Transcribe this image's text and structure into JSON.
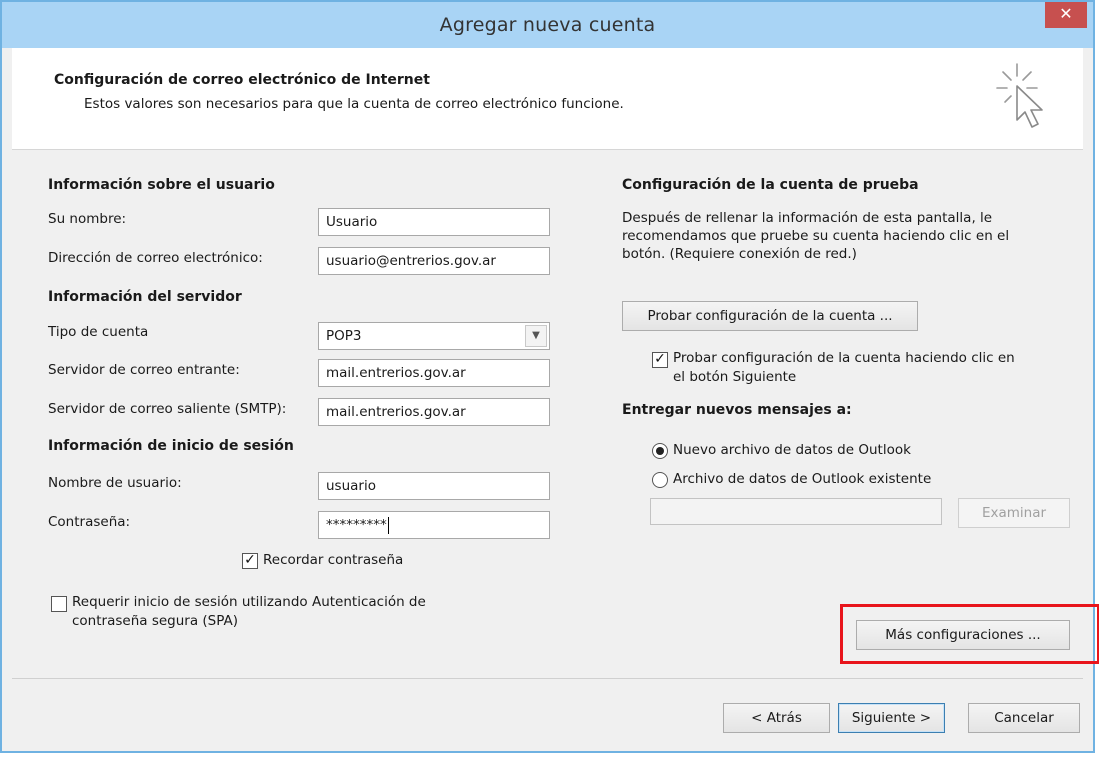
{
  "window": {
    "title": "Agregar nueva cuenta",
    "close_symbol": "✕"
  },
  "header": {
    "title": "Configuración de correo electrónico de Internet",
    "subtitle": "Estos valores son necesarios para que la cuenta de correo electrónico funcione."
  },
  "user_info": {
    "heading": "Información sobre el usuario",
    "name_label": "Su nombre:",
    "name_value": "Usuario",
    "email_label": "Dirección de correo electrónico:",
    "email_value": "usuario@entrerios.gov.ar"
  },
  "server_info": {
    "heading": "Información del servidor",
    "account_type_label": "Tipo de cuenta",
    "account_type_value": "POP3",
    "incoming_label": "Servidor de correo entrante:",
    "incoming_value": "mail.entrerios.gov.ar",
    "outgoing_label": "Servidor de correo saliente (SMTP):",
    "outgoing_value": "mail.entrerios.gov.ar"
  },
  "login_info": {
    "heading": "Información de inicio de sesión",
    "username_label": "Nombre de usuario:",
    "username_value": "usuario",
    "password_label": "Contraseña:",
    "password_value": "*********",
    "remember_label": "Recordar contraseña",
    "remember_checked": true,
    "spa_label_line1": "Requerir inicio de sesión utilizando Autenticación de",
    "spa_label_line2": "contraseña segura (SPA)",
    "spa_checked": false
  },
  "test_settings": {
    "heading": "Configuración de la cuenta de prueba",
    "description": "Después de rellenar la información de esta pantalla, le recomendamos que pruebe su cuenta haciendo clic en el botón. (Requiere conexión de red.)",
    "test_button": "Probar configuración de la cuenta ...",
    "auto_test_line1": "Probar configuración de la cuenta haciendo clic en",
    "auto_test_line2": "el botón Siguiente",
    "auto_test_checked": true
  },
  "delivery": {
    "heading": "Entregar nuevos mensajes a:",
    "option_new": "Nuevo archivo de datos de Outlook",
    "option_existing": "Archivo de datos de Outlook existente",
    "selected": "new",
    "path_value": "",
    "browse_button": "Examinar"
  },
  "more_settings_button": "Más configuraciones ...",
  "footer": {
    "back": "< Atrás",
    "next": "Siguiente >",
    "cancel": "Cancelar"
  },
  "colors": {
    "titlebar": "#a9d4f5",
    "close": "#c7504f",
    "highlight": "#e8141b"
  }
}
